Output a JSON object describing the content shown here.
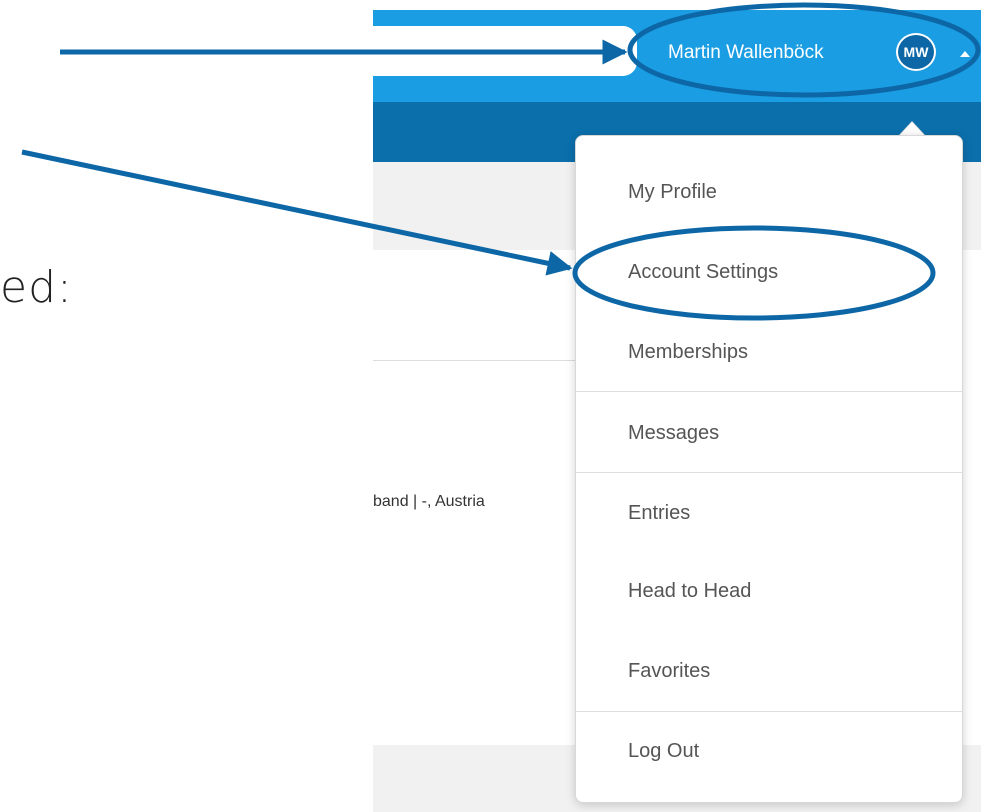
{
  "header": {
    "user_name": "Martin Wallenböck",
    "avatar_initials": "MW"
  },
  "background": {
    "slide_text": "ed:",
    "location_text": "band | -, Austria"
  },
  "dropdown": {
    "items": [
      {
        "label": "My Profile"
      },
      {
        "label": "Account Settings"
      },
      {
        "label": "Memberships"
      },
      {
        "label": "Messages"
      },
      {
        "label": "Entries"
      },
      {
        "label": "Head to Head"
      },
      {
        "label": "Favorites"
      },
      {
        "label": "Log Out"
      }
    ]
  },
  "colors": {
    "topbar": "#1a9de3",
    "navbar": "#0b6fab",
    "annotation": "#0d67a6"
  },
  "icons": [
    "caret-up-icon",
    "dropdown-pointer-icon",
    "arrow-icon"
  ]
}
